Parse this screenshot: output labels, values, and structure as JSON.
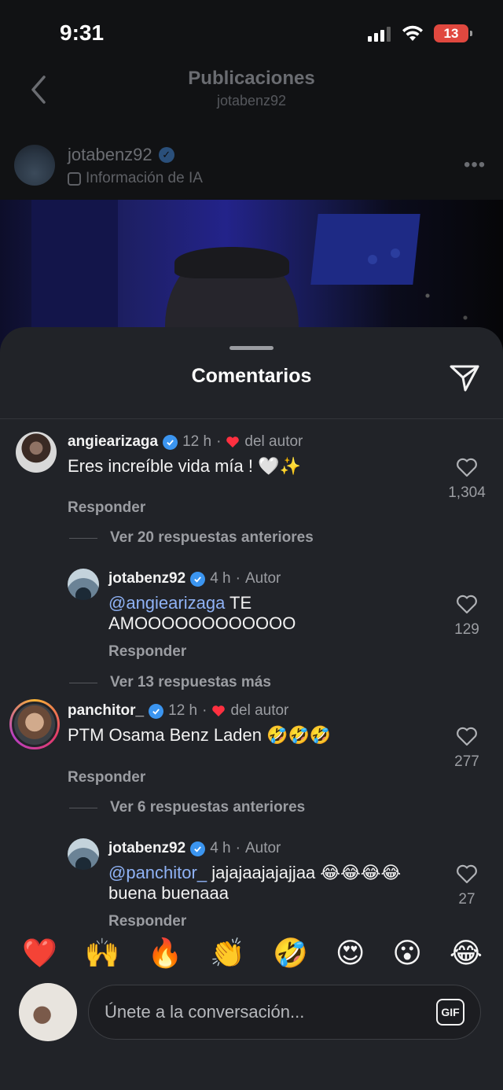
{
  "status_bar": {
    "time": "9:31",
    "battery": "13"
  },
  "nav": {
    "title": "Publicaciones",
    "subtitle": "jotabenz92"
  },
  "post": {
    "username": "jotabenz92",
    "ai_info": "Información de IA"
  },
  "sheet": {
    "title": "Comentarios"
  },
  "comments": [
    {
      "username": "angiearizaga",
      "time": "12 h",
      "author_like": "del autor",
      "text": "Eres increíble vida mía ! 🤍✨",
      "reply": "Responder",
      "likes": "1,304",
      "thread_label": "Ver 20 respuestas anteriores",
      "replies": [
        {
          "username": "jotabenz92",
          "time": "4 h",
          "role": "Autor",
          "mention": "@angiearizaga",
          "text": " TE AMOOOOOOOOOOOO",
          "reply": "Responder",
          "likes": "129"
        }
      ],
      "more_label": "Ver 13 respuestas más"
    },
    {
      "username": "panchitor_",
      "time": "12 h",
      "author_like": "del autor",
      "text": "PTM Osama Benz Laden 🤣🤣🤣",
      "reply": "Responder",
      "likes": "277",
      "thread_label": "Ver 6 respuestas anteriores",
      "replies": [
        {
          "username": "jotabenz92",
          "time": "4 h",
          "role": "Autor",
          "mention": "@panchitor_",
          "text": " jajajaajajajjaa 😂😂😂😂 buena buenaaa",
          "reply": "Responder",
          "likes": "27"
        }
      ]
    }
  ],
  "emoji_bar": [
    "❤️",
    "🙌",
    "🔥",
    "👏",
    "🤣",
    "😍",
    "😮",
    "😂"
  ],
  "composer": {
    "placeholder": "Únete a la conversación...",
    "gif_label": "GIF"
  },
  "colors": {
    "background": "#212328",
    "accent_verified": "#3b95f0",
    "mention": "#8fb2f5",
    "heart": "#ff3040"
  }
}
